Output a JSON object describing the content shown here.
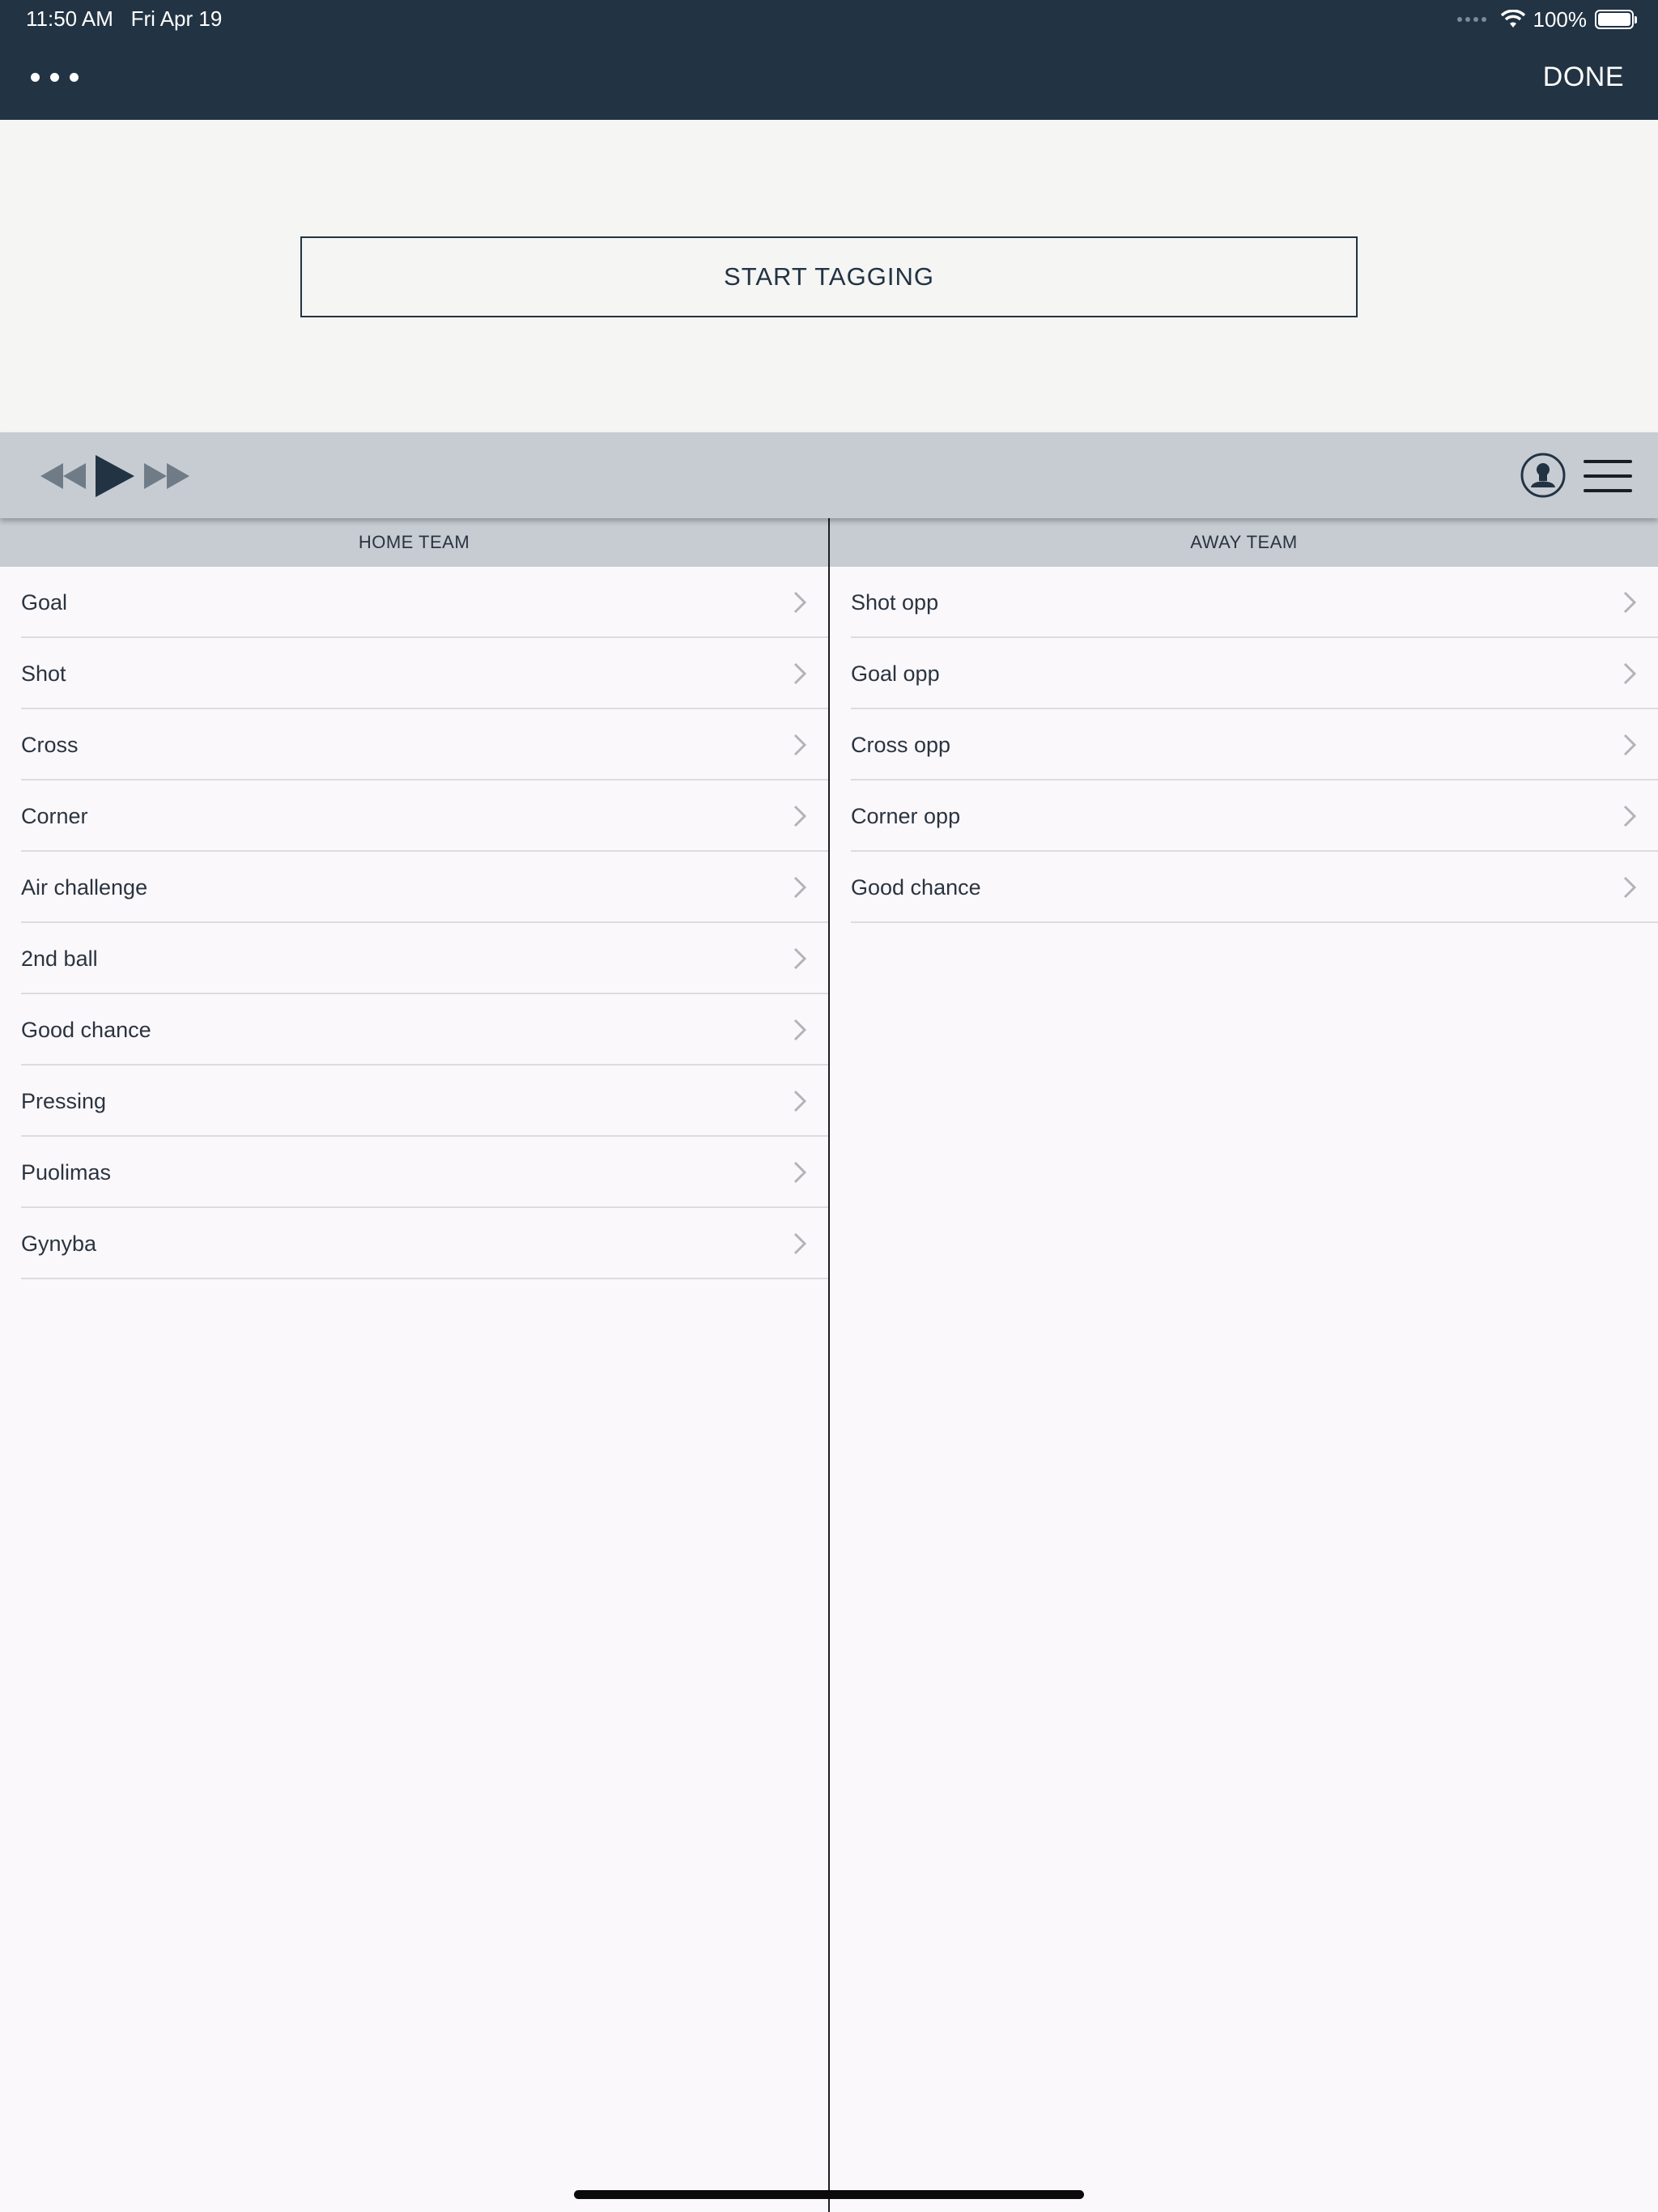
{
  "status_bar": {
    "time": "11:50 AM",
    "date": "Fri Apr 19",
    "battery": "100%"
  },
  "nav": {
    "done_label": "DONE"
  },
  "top": {
    "start_tagging_label": "START TAGGING"
  },
  "colors": {
    "header_bg": "#223343",
    "toolbar_bg": "#c7ccd2",
    "list_bg": "#fbf8fc",
    "top_bg": "#f5f5f4"
  },
  "toolbar": {
    "icons": [
      "rewind-icon",
      "play-icon",
      "fast-forward-icon",
      "user-icon",
      "hamburger-menu-icon"
    ]
  },
  "home_team": {
    "header": "HOME TEAM",
    "items": [
      {
        "label": "Goal"
      },
      {
        "label": "Shot"
      },
      {
        "label": "Cross"
      },
      {
        "label": "Corner"
      },
      {
        "label": "Air challenge"
      },
      {
        "label": "2nd ball"
      },
      {
        "label": "Good chance"
      },
      {
        "label": "Pressing"
      },
      {
        "label": "Puolimas"
      },
      {
        "label": "Gynyba"
      }
    ]
  },
  "away_team": {
    "header": "AWAY TEAM",
    "items": [
      {
        "label": "Shot opp"
      },
      {
        "label": "Goal opp"
      },
      {
        "label": "Cross opp"
      },
      {
        "label": "Corner opp"
      },
      {
        "label": "Good chance"
      }
    ]
  }
}
